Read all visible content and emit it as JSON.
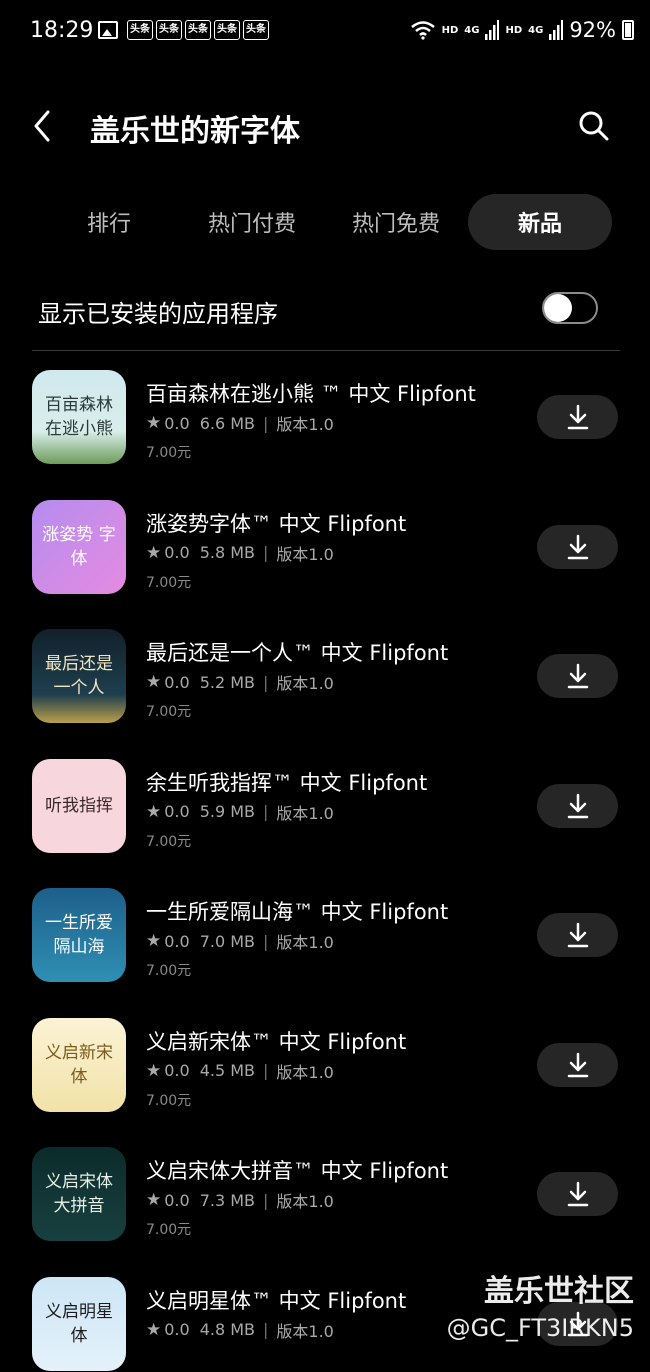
{
  "status_bar": {
    "time": "18:29",
    "notification_badges": [
      "头条",
      "头条",
      "头条",
      "头条",
      "头条"
    ],
    "network_labels": [
      "HD",
      "4G",
      "HD",
      "4G"
    ],
    "battery": "92%"
  },
  "header": {
    "title": "盖乐世的新字体"
  },
  "tabs": [
    {
      "label": "排行",
      "active": false
    },
    {
      "label": "热门付费",
      "active": false
    },
    {
      "label": "热门免费",
      "active": false
    },
    {
      "label": "新品",
      "active": true
    }
  ],
  "filter": {
    "label": "显示已安装的应用程序",
    "enabled": false
  },
  "apps": [
    {
      "name": "百亩森林在逃小熊 ™ 中文 Flipfont",
      "rating": "0.0",
      "size": "6.6 MB",
      "version": "版本1.0",
      "price": "7.00元",
      "icon_text": "百亩森林 在逃小熊"
    },
    {
      "name": "涨姿势字体™ 中文 Flipfont",
      "rating": "0.0",
      "size": "5.8 MB",
      "version": "版本1.0",
      "price": "7.00元",
      "icon_text": "涨姿势 字体"
    },
    {
      "name": "最后还是一个人™ 中文 Flipfont",
      "rating": "0.0",
      "size": "5.2 MB",
      "version": "版本1.0",
      "price": "7.00元",
      "icon_text": "最后还是 一个人"
    },
    {
      "name": "余生听我指挥™ 中文 Flipfont",
      "rating": "0.0",
      "size": "5.9 MB",
      "version": "版本1.0",
      "price": "7.00元",
      "icon_text": "听我指挥"
    },
    {
      "name": "一生所爱隔山海™ 中文 Flipfont",
      "rating": "0.0",
      "size": "7.0 MB",
      "version": "版本1.0",
      "price": "7.00元",
      "icon_text": "一生所爱 隔山海"
    },
    {
      "name": "义启新宋体™ 中文 Flipfont",
      "rating": "0.0",
      "size": "4.5 MB",
      "version": "版本1.0",
      "price": "7.00元",
      "icon_text": "义启新宋体"
    },
    {
      "name": "义启宋体大拼音™ 中文 Flipfont",
      "rating": "0.0",
      "size": "7.3 MB",
      "version": "版本1.0",
      "price": "7.00元",
      "icon_text": "义启宋体 大拼音"
    },
    {
      "name": "义启明星体™ 中文 Flipfont",
      "rating": "0.0",
      "size": "4.8 MB",
      "version": "版本1.0",
      "price": "",
      "icon_text": "义启明星体"
    }
  ],
  "watermark": {
    "title": "盖乐世社区",
    "handle": "@GC_FT3IRKN5"
  }
}
